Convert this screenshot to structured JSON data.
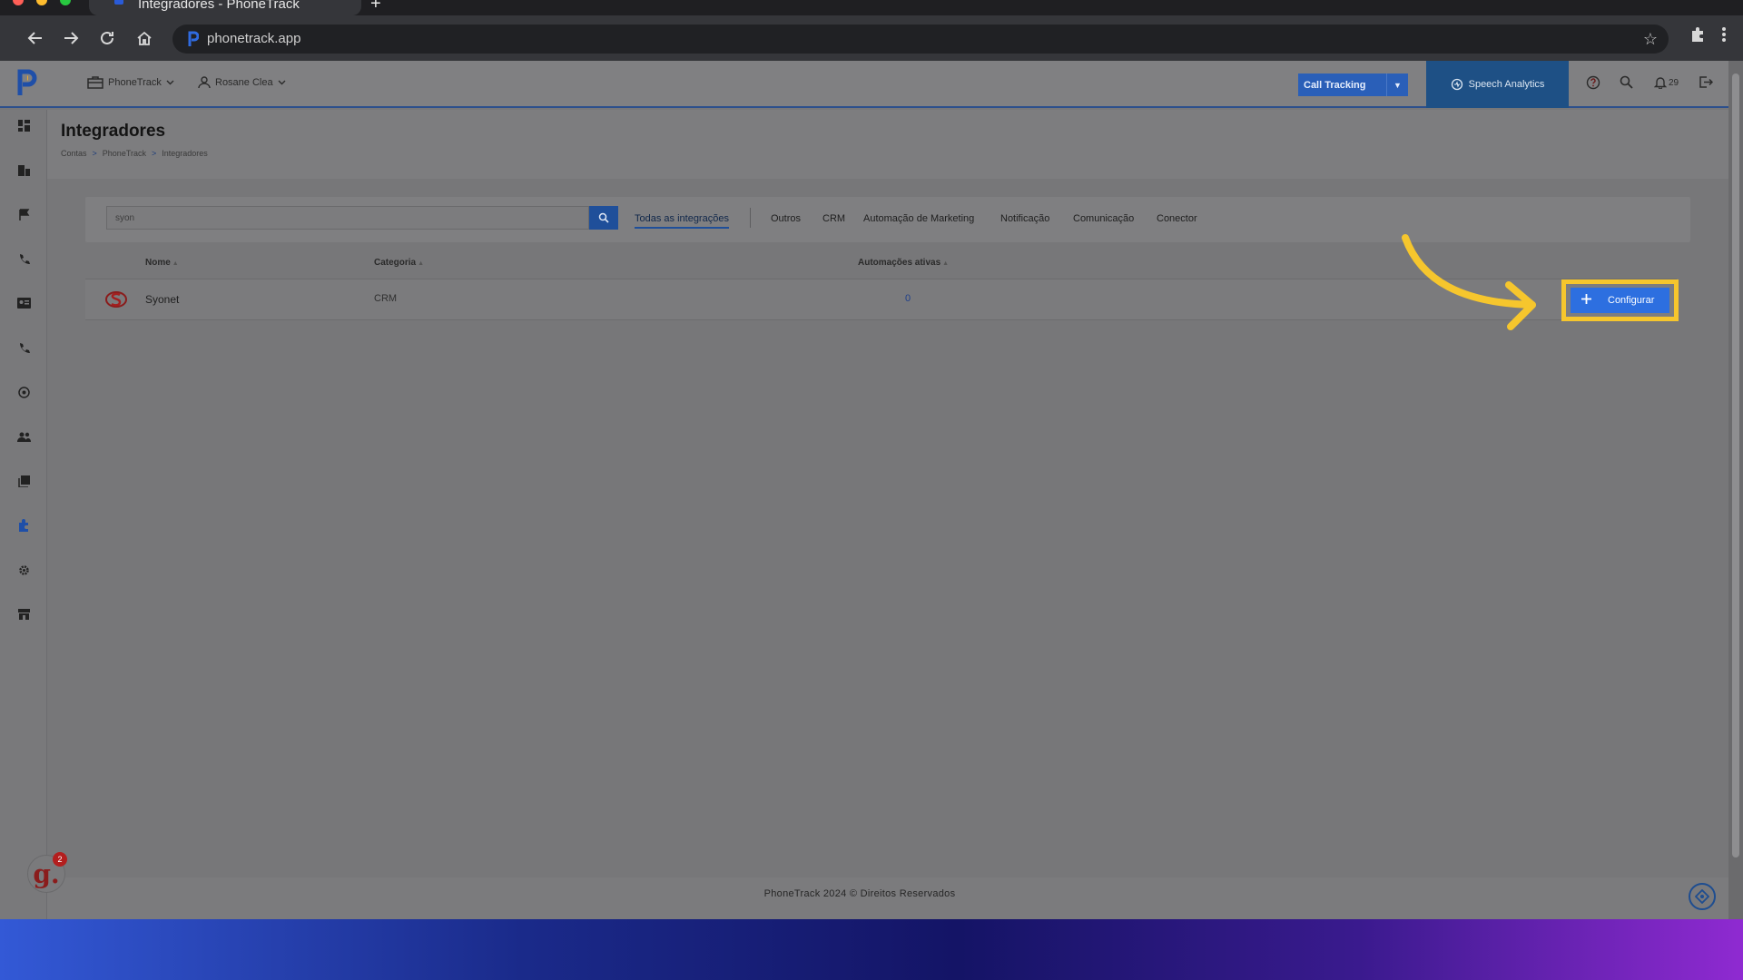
{
  "browser": {
    "tab_title": "Integradores - PhoneTrack",
    "url": "phonetrack.app"
  },
  "header": {
    "account_menu": "PhoneTrack",
    "user_menu": "Rosane Clea",
    "product_select": "Call Tracking",
    "speech_analytics": "Speech Analytics",
    "notification_count": "29"
  },
  "page": {
    "title": "Integradores",
    "breadcrumb": [
      "Contas",
      "PhoneTrack",
      "Integradores"
    ],
    "breadcrumb_sep": ">"
  },
  "filters": {
    "search_value": "syon",
    "tabs": [
      "Todas as integrações",
      "Outros",
      "CRM",
      "Automação de Marketing",
      "Notificação",
      "Comunicação",
      "Conector"
    ],
    "active_tab": "Todas as integrações"
  },
  "table": {
    "columns": [
      "Nome",
      "Categoria",
      "Automações ativas"
    ],
    "rows": [
      {
        "name": "Syonet",
        "category": "CRM",
        "active_automations": "0"
      }
    ]
  },
  "actions": {
    "configure_label": "Configurar"
  },
  "footer": {
    "text": "PhoneTrack 2024 © Direitos Reservados"
  },
  "widgets": {
    "g_badge_count": "2"
  },
  "colors": {
    "highlight": "#f6c62d",
    "primary": "#2d6fe0",
    "speech_bg": "#1e5085"
  }
}
